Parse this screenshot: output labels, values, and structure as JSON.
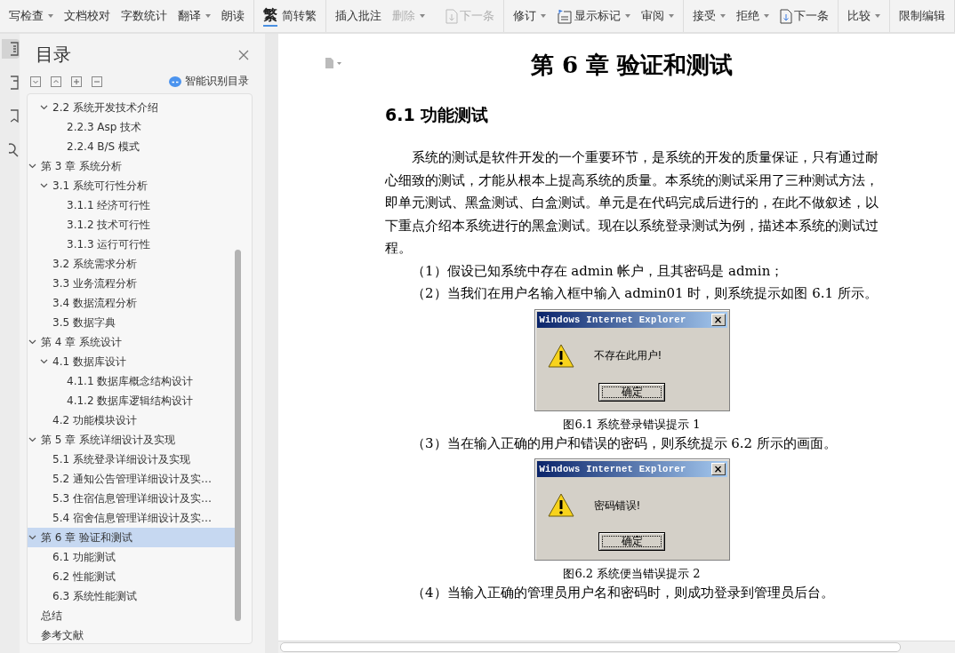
{
  "toolbar": {
    "groups": [
      [
        {
          "kind": "text",
          "label": "写检查",
          "menu": true,
          "disabled": false
        },
        {
          "kind": "text",
          "label": "文档校对",
          "menu": false,
          "disabled": false
        },
        {
          "kind": "text",
          "label": "字数统计",
          "menu": false,
          "disabled": false
        },
        {
          "kind": "text",
          "label": "翻译",
          "menu": true,
          "disabled": false
        },
        {
          "kind": "text",
          "label": "朗读",
          "menu": false,
          "disabled": false
        }
      ],
      [
        {
          "kind": "glyph",
          "glyph": "繁",
          "label": "简转繁",
          "menu": false,
          "disabled": false
        }
      ],
      [
        {
          "kind": "text",
          "label": "插入批注",
          "menu": false,
          "disabled": false
        },
        {
          "kind": "text",
          "label": "删除",
          "menu": true,
          "disabled": true
        },
        {
          "kind": "next",
          "label": "下一条",
          "menu": false,
          "disabled": true
        }
      ],
      [
        {
          "kind": "text",
          "label": "修订",
          "menu": true,
          "disabled": false
        },
        {
          "kind": "markup",
          "label": "显示标记",
          "menu": true,
          "disabled": false
        },
        {
          "kind": "text",
          "label": "审阅",
          "menu": true,
          "disabled": false
        }
      ],
      [
        {
          "kind": "text",
          "label": "接受",
          "menu": true,
          "disabled": false
        },
        {
          "kind": "text",
          "label": "拒绝",
          "menu": true,
          "disabled": false
        },
        {
          "kind": "next",
          "label": "下一条",
          "menu": false,
          "disabled": false
        }
      ],
      [
        {
          "kind": "text",
          "label": "比较",
          "menu": true,
          "disabled": false
        }
      ],
      [
        {
          "kind": "text",
          "label": "限制编辑",
          "menu": false,
          "disabled": false
        }
      ]
    ]
  },
  "sidebar": {
    "title": "目录",
    "smart_button": "智能识别目录",
    "items": [
      {
        "children": [
          {
            "label": "2.2  系统开发技术介绍",
            "expanded": true,
            "selected": false,
            "children": [
              {
                "label": "2.2.3 Asp 技术",
                "selected": false
              },
              {
                "label": "2.2.4 B/S 模式",
                "selected": false
              }
            ]
          }
        ]
      },
      {
        "label": "第 3 章  系统分析",
        "expanded": true,
        "selected": false,
        "children": [
          {
            "label": "3.1  系统可行性分析",
            "expanded": true,
            "selected": false,
            "children": [
              {
                "label": "3.1.1  经济可行性",
                "selected": false
              },
              {
                "label": "3.1.2  技术可行性",
                "selected": false
              },
              {
                "label": "3.1.3  运行可行性",
                "selected": false
              }
            ]
          },
          {
            "label": "3.2  系统需求分析",
            "selected": false
          },
          {
            "label": "3.3  业务流程分析",
            "selected": false
          },
          {
            "label": "3.4  数据流程分析",
            "selected": false
          },
          {
            "label": "3.5  数据字典",
            "selected": false
          }
        ]
      },
      {
        "label": "第 4 章  系统设计",
        "expanded": true,
        "selected": false,
        "children": [
          {
            "label": "4.1 数据库设计",
            "expanded": true,
            "selected": false,
            "children": [
              {
                "label": "4.1.1  数据库概念结构设计",
                "selected": false
              },
              {
                "label": "4.1.2  数据库逻辑结构设计",
                "selected": false
              }
            ]
          },
          {
            "label": "4.2 功能模块设计",
            "selected": false
          }
        ]
      },
      {
        "label": "第 5 章  系统详细设计及实现",
        "expanded": true,
        "selected": false,
        "children": [
          {
            "label": "5.1  系统登录详细设计及实现",
            "selected": false
          },
          {
            "label": "5.2  通知公告管理详细设计及实…",
            "selected": false
          },
          {
            "label": "5.3  住宿信息管理详细设计及实…",
            "selected": false
          },
          {
            "label": "5.4  宿舍信息管理详细设计及实…",
            "selected": false
          }
        ]
      },
      {
        "label": "第 6 章  验证和测试",
        "expanded": true,
        "selected": true,
        "children": [
          {
            "label": "6.1  功能测试",
            "selected": false
          },
          {
            "label": "6.2 性能测试",
            "selected": false
          },
          {
            "label": "6.3  系统性能测试",
            "selected": false
          }
        ]
      },
      {
        "label": "总结",
        "selected": false
      },
      {
        "label": "参考文献",
        "selected": false
      }
    ]
  },
  "document": {
    "chapter_title": "第 6 章  验证和测试",
    "section_title": "6.1  功能测试",
    "blocks": [
      {
        "kind": "para",
        "text": "系统的测试是软件开发的一个重要环节，是系统的开发的质量保证，只有通过耐心细致的测试，才能从根本上提高系统的质量。本系统的测试采用了三种测试方法，即单元测试、黑盒测试、白盒测试。单元是在代码完成后进行的，在此不做叙述，以下重点介绍本系统进行的黑盒测试。现在以系统登录测试为例，描述本系统的测试过程。"
      },
      {
        "kind": "para",
        "text": "（1）假设已知系统中存在 admin 帐户，且其密码是 admin；"
      },
      {
        "kind": "para",
        "text": "（2）当我们在用户名输入框中输入 admin01 时，则系统提示如图 6.1 所示。"
      },
      {
        "kind": "dialog",
        "title": "Windows Internet Explorer",
        "close": "×",
        "message": "不存在此用户!",
        "button": "确定"
      },
      {
        "kind": "caption",
        "text": "图6.1 系统登录错误提示 1"
      },
      {
        "kind": "para",
        "text": "（3）当在输入正确的用户和错误的密码，则系统提示 6.2 所示的画面。"
      },
      {
        "kind": "dialog",
        "title": "Windows Internet Explorer",
        "close": "×",
        "message": "密码错误!",
        "button": "确定"
      },
      {
        "kind": "caption",
        "text": "图6.2 系统便当错误提示 2"
      },
      {
        "kind": "para",
        "text": "（4）当输入正确的管理员用户名和密码时，则成功登录到管理员后台。"
      }
    ]
  }
}
